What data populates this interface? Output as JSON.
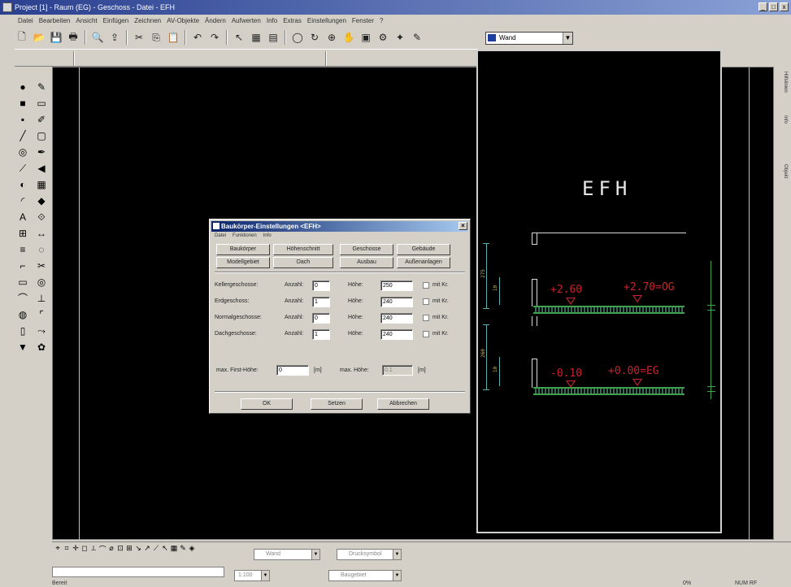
{
  "app": {
    "title": "Project [1] - Raum (EG) - Geschoss - Datei - EFH",
    "window_buttons": [
      "_",
      "□",
      "x"
    ]
  },
  "menu": [
    "Datei",
    "Bearbeiten",
    "Ansicht",
    "Einfügen",
    "Zeichnen",
    "AV-Objekte",
    "Ändern",
    "Aufwerten",
    "Info",
    "Extras",
    "Einstellungen",
    "Fenster",
    "?"
  ],
  "toolbar": {
    "icons": [
      "new-icon",
      "open-icon",
      "save-icon",
      "print-icon",
      "preview-icon",
      "export-icon",
      "cut-icon",
      "copy-icon",
      "paste-icon",
      "undo-icon",
      "redo-icon",
      "pointer-icon",
      "grid-icon",
      "layer-icon",
      "circle-icon",
      "rotate-icon",
      "zoom-icon",
      "pan-icon",
      "view-icon",
      "settings-icon",
      "wizard-icon",
      "pen-icon"
    ],
    "glyphs": [
      "🗋",
      "📂",
      "💾",
      "🖶",
      "🔍",
      "⇪",
      "✂",
      "⎘",
      "📋",
      "↶",
      "↷",
      "↖",
      "▦",
      "▤",
      "◯",
      "↻",
      "⊕",
      "✋",
      "▣",
      "⚙",
      "✦",
      "✎"
    ]
  },
  "layer_select": {
    "value": "Wand"
  },
  "left_tools": [
    "●",
    "✎",
    "■",
    "▭",
    "▪",
    "✐",
    "╱",
    "▢",
    "◎",
    "✒",
    "⟋",
    "◀",
    "◐",
    "▦",
    "◜",
    "◆",
    "A",
    "⟐",
    "⊞",
    "↔",
    "≡",
    "◌",
    "⌐",
    "✂",
    "▭",
    "◎",
    "⌒",
    "⊥",
    "◍",
    "⌜",
    "▯",
    "⤳",
    "▼",
    "✿"
  ],
  "right_tabs": [
    "Hilfslinien",
    "Info",
    "Objekt"
  ],
  "drawing": {
    "title_text": "EFH",
    "levels": [
      {
        "label": "+2.60",
        "label2": "+2.70=OG"
      },
      {
        "label": "-0.10",
        "label2": "+0.00=EG"
      }
    ],
    "dims": [
      "275",
      "260",
      "10",
      "10"
    ]
  },
  "dialog": {
    "title": "Baukörper-Einstellungen <EFH>",
    "menu": [
      "Datei",
      "Funktionen",
      "Info"
    ],
    "tabs_row1": [
      "Baukörper",
      "Höhenschnitt",
      "Geschosse",
      "Gebäude"
    ],
    "tabs_row2": [
      "Modellgebiet",
      "Dach",
      "Ausbau",
      "Außenanlagen"
    ],
    "rows": [
      {
        "label": "Kellergeschosse:",
        "anzahl_label": "Anzahl:",
        "anzahl": "0",
        "hoehe_label": "Höhe:",
        "hoehe": "250",
        "check_label": "mit Kr."
      },
      {
        "label": "Erdgeschoss:",
        "anzahl_label": "Anzahl:",
        "anzahl": "1",
        "hoehe_label": "Höhe:",
        "hoehe": "240",
        "check_label": "mit Kr."
      },
      {
        "label": "Normalgeschosse:",
        "anzahl_label": "Anzahl:",
        "anzahl": "0",
        "hoehe_label": "Höhe:",
        "hoehe": "240",
        "check_label": "mit Kr."
      },
      {
        "label": "Dachgeschosse:",
        "anzahl_label": "Anzahl:",
        "anzahl": "1",
        "hoehe_label": "Höhe:",
        "hoehe": "240",
        "check_label": "mit Kr."
      }
    ],
    "first_floor_label": "max. First-Höhe:",
    "first_floor_value": "0",
    "unit1": "[m]",
    "max_height_label": "max. Höhe:",
    "max_height_value": "0.1",
    "unit2": "[m]",
    "buttons": {
      "ok": "OK",
      "apply": "Setzen",
      "cancel": "Abbrechen"
    }
  },
  "bottom": {
    "combo1": "Wand",
    "combo2": "Drucksymbol",
    "combo3": "1:100",
    "combo4": "Baugebiet",
    "status_left": "Bereit",
    "status_right1": "0%",
    "status_right2": "NUM  RF"
  }
}
